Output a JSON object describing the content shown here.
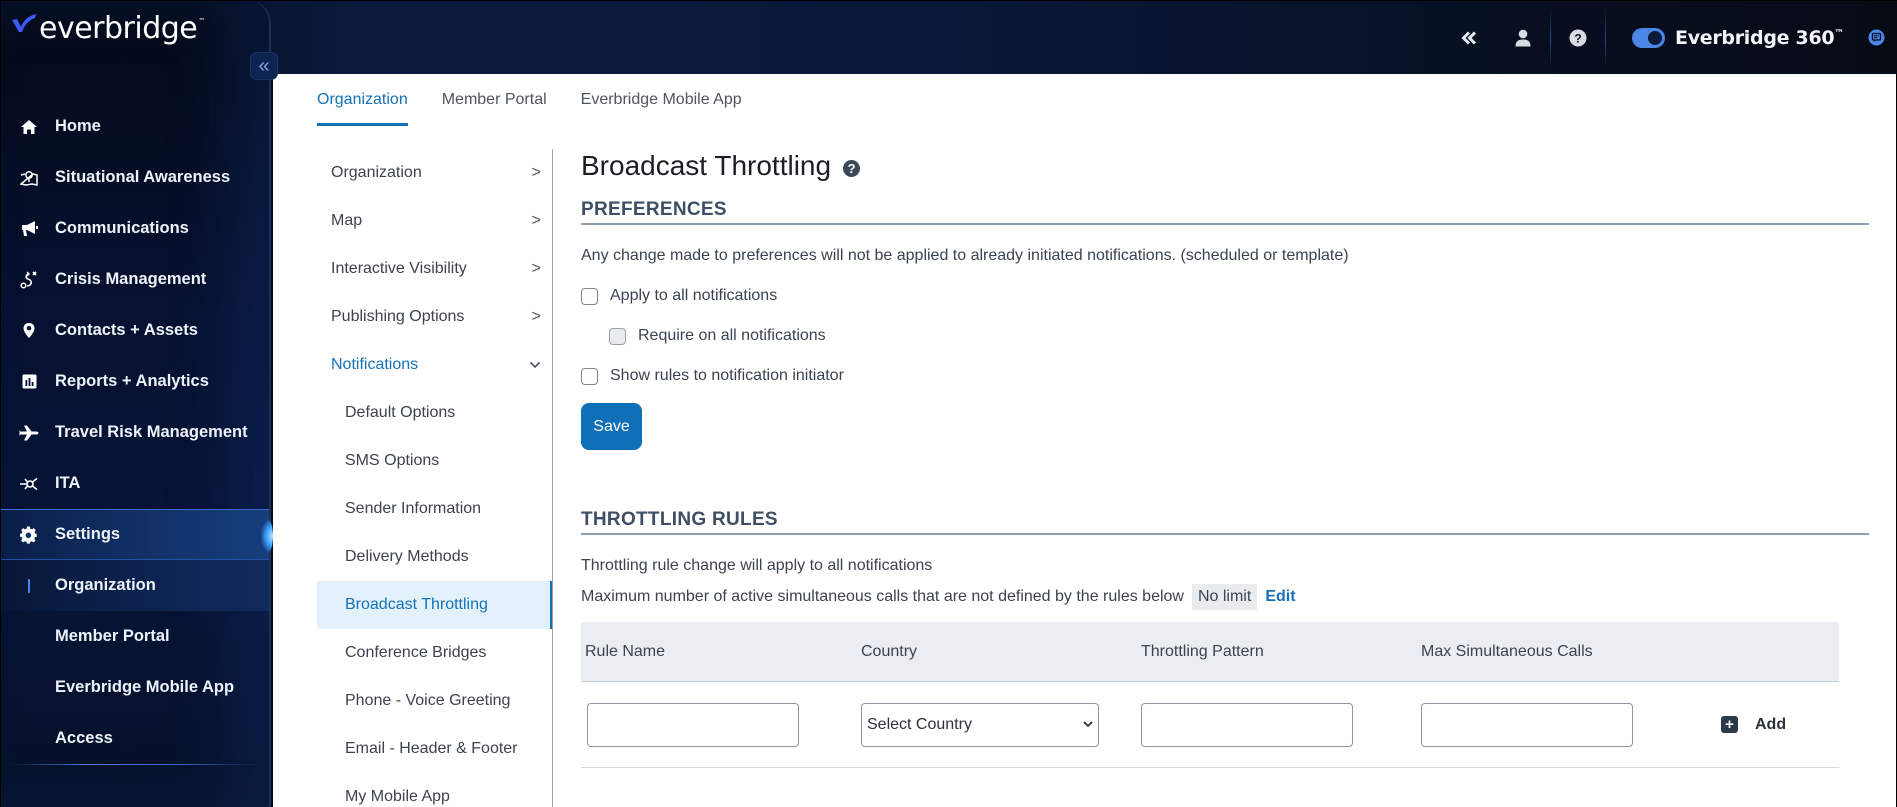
{
  "app": {
    "logo_text": "everbridge",
    "logo_tm": "™",
    "product_label": "Everbridge 360",
    "product_tm": "™",
    "product_toggle_on": true
  },
  "top_actions": [
    {
      "name": "collapse-all-icon",
      "glyph": "«"
    },
    {
      "name": "user-icon",
      "glyph": "person"
    },
    {
      "name": "help-icon",
      "glyph": "?"
    }
  ],
  "sidebar": {
    "collapse_glyph": "«",
    "items": [
      {
        "label": "Home",
        "icon": "home-icon"
      },
      {
        "label": "Situational Awareness",
        "icon": "map-pin-icon"
      },
      {
        "label": "Communications",
        "icon": "megaphone-icon"
      },
      {
        "label": "Crisis Management",
        "icon": "route-icon"
      },
      {
        "label": "Contacts + Assets",
        "icon": "location-pin-icon"
      },
      {
        "label": "Reports + Analytics",
        "icon": "bar-chart-icon"
      },
      {
        "label": "Travel Risk Management",
        "icon": "airplane-icon"
      },
      {
        "label": "ITA",
        "icon": "network-icon"
      },
      {
        "label": "Settings",
        "icon": "gear-icon",
        "active": true
      }
    ],
    "sub_items": [
      {
        "label": "Organization",
        "current": true
      },
      {
        "label": "Member Portal"
      },
      {
        "label": "Everbridge Mobile App"
      },
      {
        "label": "Access"
      }
    ]
  },
  "tabs": [
    {
      "label": "Organization",
      "active": true
    },
    {
      "label": "Member Portal"
    },
    {
      "label": "Everbridge Mobile App"
    }
  ],
  "left_menu": {
    "items": [
      {
        "label": "Organization",
        "chevron": ">"
      },
      {
        "label": "Map",
        "chevron": ">"
      },
      {
        "label": "Interactive Visibility",
        "chevron": ">"
      },
      {
        "label": "Publishing Options",
        "chevron": ">"
      },
      {
        "label": "Notifications",
        "chevron": "⌄",
        "open": true
      }
    ],
    "sub_items": [
      {
        "label": "Default Options"
      },
      {
        "label": "SMS Options"
      },
      {
        "label": "Sender Information"
      },
      {
        "label": "Delivery Methods"
      },
      {
        "label": "Broadcast Throttling",
        "selected": true
      },
      {
        "label": "Conference Bridges"
      },
      {
        "label": "Phone - Voice Greeting"
      },
      {
        "label": "Email - Header & Footer"
      },
      {
        "label": "My Mobile App"
      }
    ]
  },
  "page": {
    "title": "Broadcast Throttling",
    "help_glyph": "?",
    "preferences": {
      "heading": "PREFERENCES",
      "note": "Any change made to preferences will not be applied to already initiated notifications. (scheduled or template)",
      "options": [
        {
          "label": "Apply to all notifications",
          "checked": false
        },
        {
          "label": "Require on all notifications",
          "checked": false,
          "disabled": true
        },
        {
          "label": "Show rules to notification initiator",
          "checked": false
        }
      ],
      "save_label": "Save"
    },
    "throttling_rules": {
      "heading": "THROTTLING RULES",
      "note": "Throttling rule change will apply to all notifications",
      "max_label": "Maximum number of active simultaneous calls that are not defined by the rules below",
      "max_value": "No limit",
      "edit_label": "Edit",
      "columns": [
        "Rule Name",
        "Country",
        "Throttling Pattern",
        "Max Simultaneous Calls"
      ],
      "new_row": {
        "rule_name": "",
        "country_selected": "Select Country",
        "throttling_pattern": "",
        "max_calls": "",
        "add_label": "Add"
      }
    }
  },
  "colors": {
    "accent": "#1672b8",
    "save_button": "#0f70b7",
    "sidebar_bg": "#071232",
    "selected_bg": "#e3f1fb"
  }
}
